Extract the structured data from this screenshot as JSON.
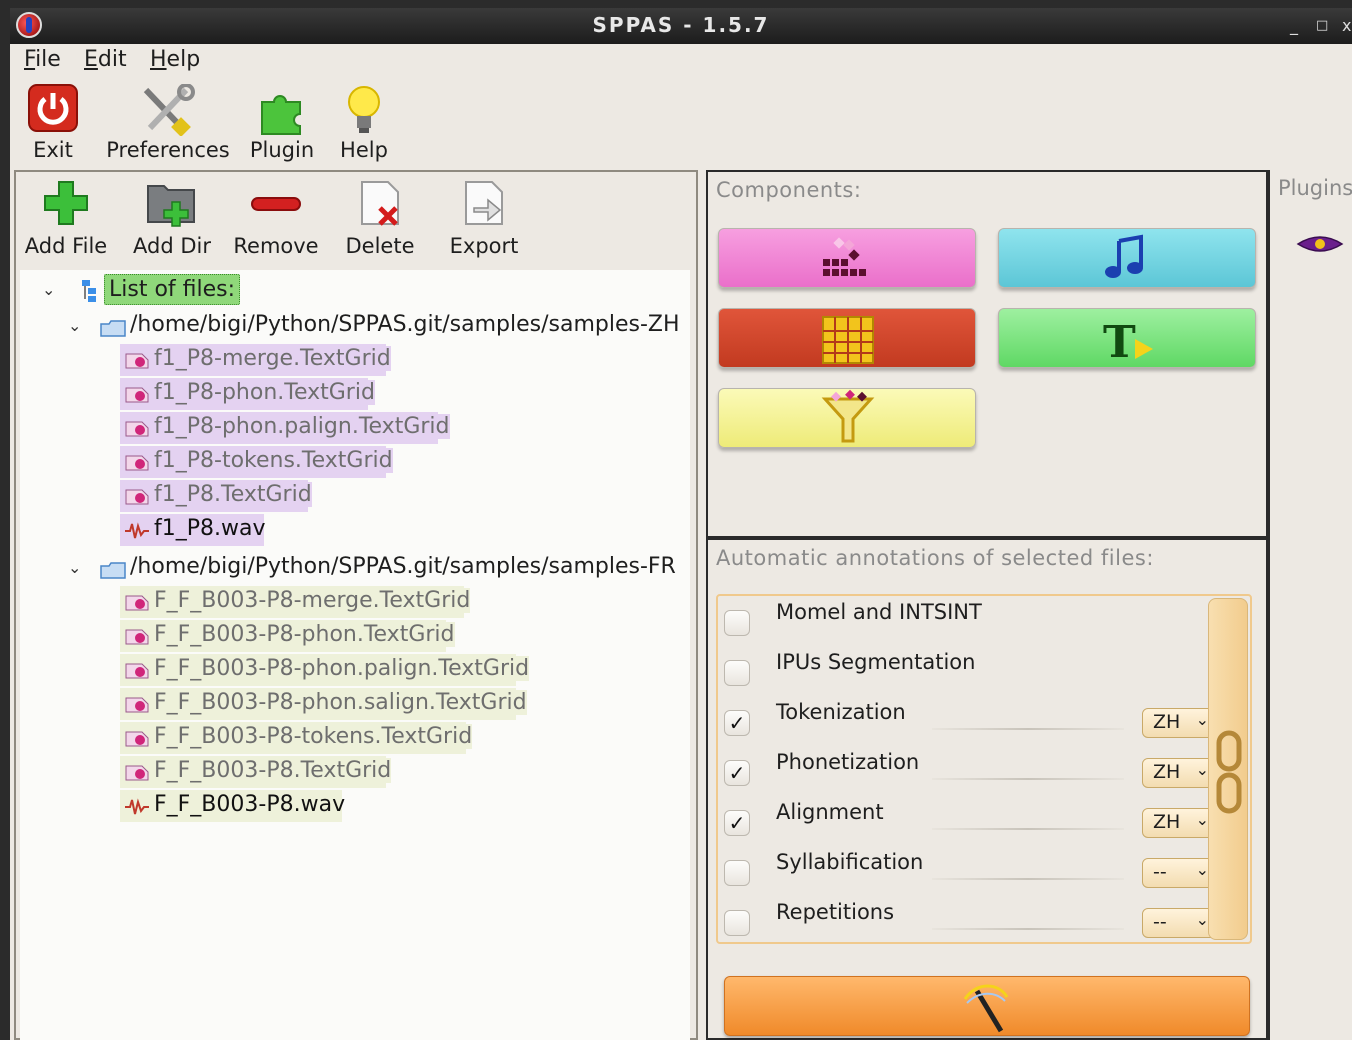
{
  "window": {
    "title": "SPPAS  -  1.5.7",
    "controls": [
      "_",
      "□",
      "x"
    ]
  },
  "menu": {
    "items": [
      {
        "label": "File",
        "mnemonic": "F",
        "rest": "ile"
      },
      {
        "label": "Edit",
        "mnemonic": "E",
        "rest": "dit"
      },
      {
        "label": "Help",
        "mnemonic": "H",
        "rest": "elp"
      }
    ]
  },
  "toolbar": {
    "exit": "Exit",
    "preferences": "Preferences",
    "plugin": "Plugin",
    "help": "Help"
  },
  "filebar": {
    "add_file": "Add File",
    "add_dir": "Add Dir",
    "remove": "Remove",
    "delete": "Delete",
    "export": "Export"
  },
  "tree": {
    "root": "List of files:",
    "dirs": [
      {
        "path": "/home/bigi/Python/SPPAS.git/samples/samples-ZH",
        "files": [
          "f1_P8-merge.TextGrid",
          "f1_P8-phon.TextGrid",
          "f1_P8-phon.palign.TextGrid",
          "f1_P8-tokens.TextGrid",
          "f1_P8.TextGrid",
          "f1_P8.wav"
        ]
      },
      {
        "path": "/home/bigi/Python/SPPAS.git/samples/samples-FR",
        "files": [
          "F_F_B003-P8-merge.TextGrid",
          "F_F_B003-P8-phon.TextGrid",
          "F_F_B003-P8-phon.palign.TextGrid",
          "F_F_B003-P8-phon.salign.TextGrid",
          "F_F_B003-P8-tokens.TextGrid",
          "F_F_B003-P8.TextGrid",
          "F_F_B003-P8.wav"
        ]
      }
    ]
  },
  "components": {
    "header": "Components:",
    "colors": {
      "pink": "#f07ad0",
      "cyan": "#72d4e0",
      "red": "#d24a2c",
      "green": "#78e07c",
      "yellow": "#f5f39a"
    }
  },
  "annotations": {
    "header": "Automatic annotations of selected files:",
    "items": [
      {
        "name": "Momel and INTSINT",
        "checked": "",
        "lang": ""
      },
      {
        "name": "IPUs Segmentation",
        "checked": "",
        "lang": ""
      },
      {
        "name": "Tokenization",
        "checked": "✓",
        "lang": "ZH"
      },
      {
        "name": "Phonetization",
        "checked": "✓",
        "lang": "ZH"
      },
      {
        "name": "Alignment",
        "checked": "✓",
        "lang": "ZH"
      },
      {
        "name": "Syllabification",
        "checked": "",
        "lang": "--"
      },
      {
        "name": "Repetitions",
        "checked": "",
        "lang": "--"
      }
    ],
    "dropdown_arrow": "⌄"
  },
  "plugins": {
    "header": "Plugins"
  }
}
